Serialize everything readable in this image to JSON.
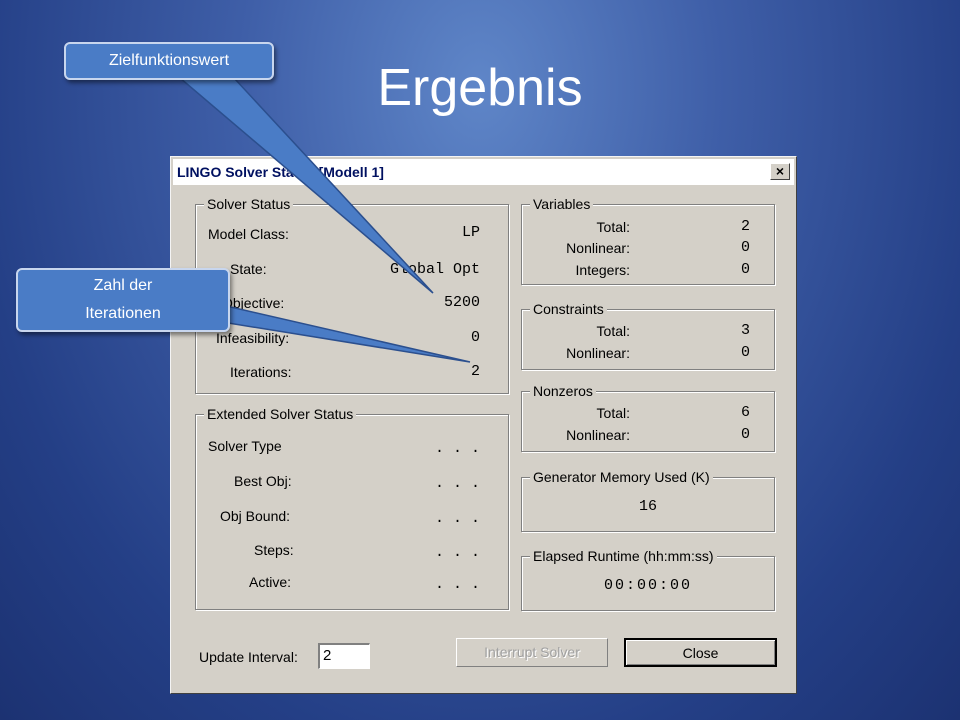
{
  "slide": {
    "title": "Ergebnis"
  },
  "window": {
    "title": "LINGO Solver Status [Modell 1]",
    "close_glyph": "×"
  },
  "solver_status": {
    "label": "Solver Status",
    "rows": [
      {
        "name": "Model Class:",
        "value": "LP"
      },
      {
        "name": "State:",
        "value": "Global Opt"
      },
      {
        "name": "Objective:",
        "value": "5200"
      },
      {
        "name": "Infeasibility:",
        "value": "0"
      },
      {
        "name": "Iterations:",
        "value": "2"
      }
    ]
  },
  "extended_status": {
    "label": "Extended Solver Status",
    "rows": [
      {
        "name": "Solver Type",
        "value": ". . ."
      },
      {
        "name": "Best Obj:",
        "value": ". . ."
      },
      {
        "name": "Obj Bound:",
        "value": ". . ."
      },
      {
        "name": "Steps:",
        "value": ". . ."
      },
      {
        "name": "Active:",
        "value": ". . ."
      }
    ]
  },
  "variables": {
    "label": "Variables",
    "rows": [
      {
        "name": "Total:",
        "value": "2"
      },
      {
        "name": "Nonlinear:",
        "value": "0"
      },
      {
        "name": "Integers:",
        "value": "0"
      }
    ]
  },
  "constraints": {
    "label": "Constraints",
    "rows": [
      {
        "name": "Total:",
        "value": "3"
      },
      {
        "name": "Nonlinear:",
        "value": "0"
      }
    ]
  },
  "nonzeros": {
    "label": "Nonzeros",
    "rows": [
      {
        "name": "Total:",
        "value": "6"
      },
      {
        "name": "Nonlinear:",
        "value": "0"
      }
    ]
  },
  "memory": {
    "label": "Generator Memory Used (K)",
    "value": "16"
  },
  "runtime": {
    "label": "Elapsed Runtime (hh:mm:ss)",
    "value": "00:00:00"
  },
  "footer": {
    "update_interval_label": "Update Interval:",
    "update_interval_value": "2",
    "interrupt_label": "Interrupt Solver",
    "close_label": "Close"
  },
  "callouts": {
    "objective": "Zielfunktionswert",
    "iterations_line1": "Zahl der",
    "iterations_line2": "Iterationen"
  },
  "colors": {
    "callout_fill": "#4a7cc6",
    "background": "#2a4890"
  }
}
